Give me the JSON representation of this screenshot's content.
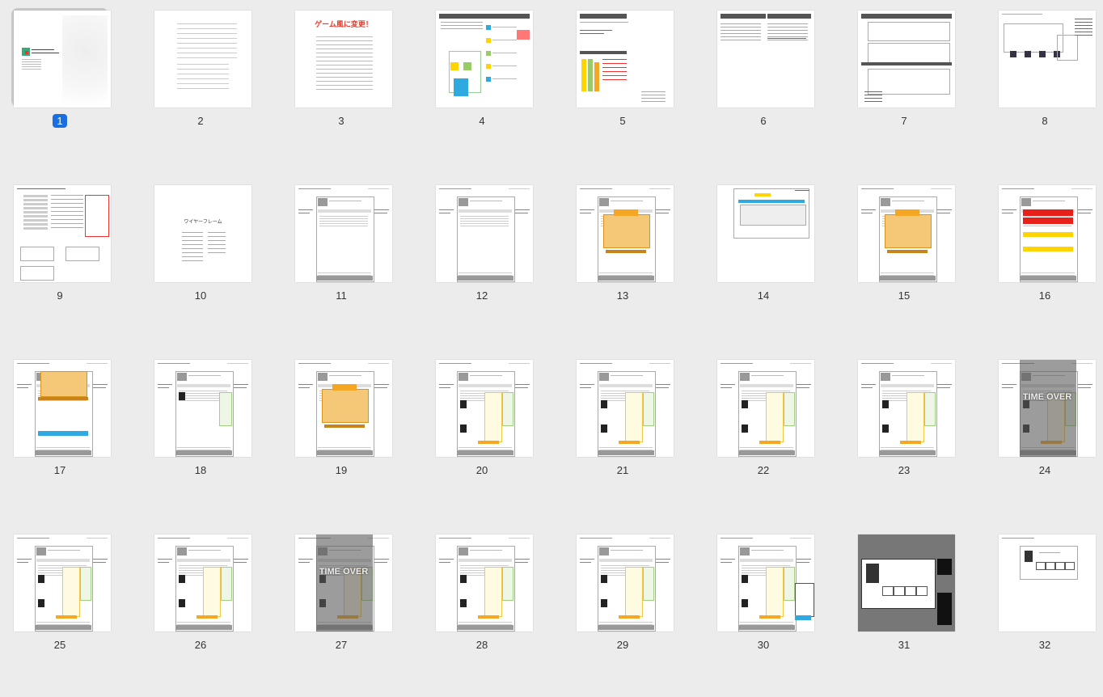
{
  "slides": [
    {
      "number": "1",
      "kind": "cover",
      "selected": true
    },
    {
      "number": "2",
      "kind": "text"
    },
    {
      "number": "3",
      "kind": "title",
      "title": "ゲーム風に変更！"
    },
    {
      "number": "4",
      "kind": "diagram"
    },
    {
      "number": "5",
      "kind": "doc"
    },
    {
      "number": "6",
      "kind": "doc2"
    },
    {
      "number": "7",
      "kind": "wire"
    },
    {
      "number": "8",
      "kind": "wire2"
    },
    {
      "number": "9",
      "kind": "wire3"
    },
    {
      "number": "10",
      "kind": "toc",
      "title": "ワイヤーフレーム"
    },
    {
      "number": "11",
      "kind": "screen"
    },
    {
      "number": "12",
      "kind": "screen"
    },
    {
      "number": "13",
      "kind": "game"
    },
    {
      "number": "14",
      "kind": "modal"
    },
    {
      "number": "15",
      "kind": "game"
    },
    {
      "number": "16",
      "kind": "red"
    },
    {
      "number": "17",
      "kind": "game2"
    },
    {
      "number": "18",
      "kind": "screen2"
    },
    {
      "number": "19",
      "kind": "game"
    },
    {
      "number": "20",
      "kind": "screen3"
    },
    {
      "number": "21",
      "kind": "screen3"
    },
    {
      "number": "22",
      "kind": "screen3"
    },
    {
      "number": "23",
      "kind": "screen3"
    },
    {
      "number": "24",
      "kind": "timeover",
      "overlay": "TIME OVER"
    },
    {
      "number": "25",
      "kind": "screen3"
    },
    {
      "number": "26",
      "kind": "screen3"
    },
    {
      "number": "27",
      "kind": "timeover",
      "overlay": "TIME OVER"
    },
    {
      "number": "28",
      "kind": "screen3"
    },
    {
      "number": "29",
      "kind": "screen3"
    },
    {
      "number": "30",
      "kind": "screen4"
    },
    {
      "number": "31",
      "kind": "dark"
    },
    {
      "number": "32",
      "kind": "profile"
    }
  ],
  "colors": {
    "selected": "#1a6fe0",
    "accent_orange": "#f5a623",
    "accent_blue": "#2eaae1",
    "accent_red": "#e63a2c",
    "accent_yellow": "#ffd400"
  }
}
